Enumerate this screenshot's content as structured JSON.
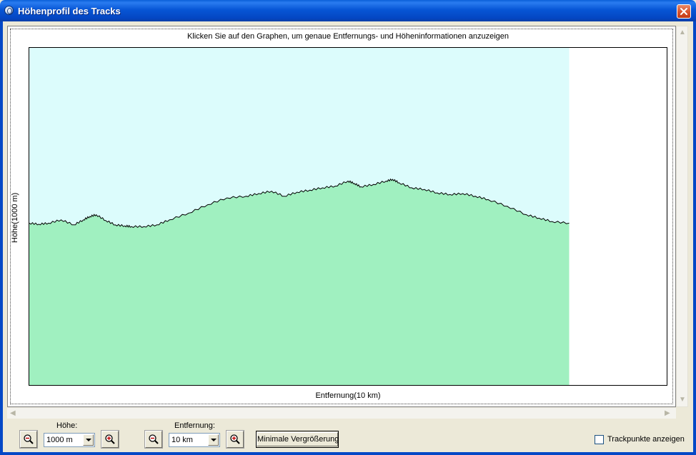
{
  "window": {
    "title": "Höhenprofil des Tracks",
    "icon": "globe-icon",
    "close_icon": "close-icon"
  },
  "graph": {
    "instruction": "Klicken Sie auf den Graphen, um genaue Entfernungs- und Höheninformationen anzuzeigen",
    "ylabel": "Höhe(1000 m)",
    "xlabel": "Entfernung(10 km)",
    "colors": {
      "sky": "#dcfcfc",
      "terrain": "#a0f0c0",
      "line": "#000000",
      "background": "#ffffff"
    }
  },
  "chart_data": {
    "type": "area",
    "title": "",
    "xlabel": "Entfernung(10 km)",
    "ylabel": "Höhe(1000 m)",
    "grid": false,
    "legend": "none",
    "xlim": [
      0,
      1
    ],
    "ylim": [
      0,
      1
    ],
    "data_end_x": 0.847,
    "x": [
      0.0,
      0.015,
      0.03,
      0.05,
      0.07,
      0.085,
      0.095,
      0.105,
      0.12,
      0.135,
      0.15,
      0.16,
      0.18,
      0.2,
      0.22,
      0.25,
      0.28,
      0.31,
      0.34,
      0.36,
      0.38,
      0.4,
      0.42,
      0.44,
      0.46,
      0.48,
      0.5,
      0.51,
      0.52,
      0.54,
      0.56,
      0.57,
      0.58,
      0.6,
      0.62,
      0.64,
      0.66,
      0.68,
      0.7,
      0.72,
      0.75,
      0.78,
      0.8,
      0.82,
      0.847
    ],
    "values": [
      0.48,
      0.477,
      0.48,
      0.49,
      0.475,
      0.49,
      0.5,
      0.505,
      0.488,
      0.475,
      0.472,
      0.47,
      0.47,
      0.475,
      0.49,
      0.51,
      0.535,
      0.555,
      0.56,
      0.568,
      0.575,
      0.56,
      0.572,
      0.578,
      0.585,
      0.59,
      0.605,
      0.598,
      0.588,
      0.595,
      0.605,
      0.61,
      0.6,
      0.585,
      0.58,
      0.57,
      0.565,
      0.568,
      0.56,
      0.55,
      0.53,
      0.505,
      0.495,
      0.485,
      0.48
    ]
  },
  "controls": {
    "height_label": "Höhe:",
    "height_value": "1000 m",
    "distance_label": "Entfernung:",
    "distance_value": "10 km",
    "min_zoom_label": "Minimale Vergrößerung",
    "trackpoints_label": "Trackpunkte anzeigen",
    "trackpoints_checked": false,
    "zoom_out_icon": "zoom-out-icon",
    "zoom_in_icon": "zoom-in-icon"
  }
}
